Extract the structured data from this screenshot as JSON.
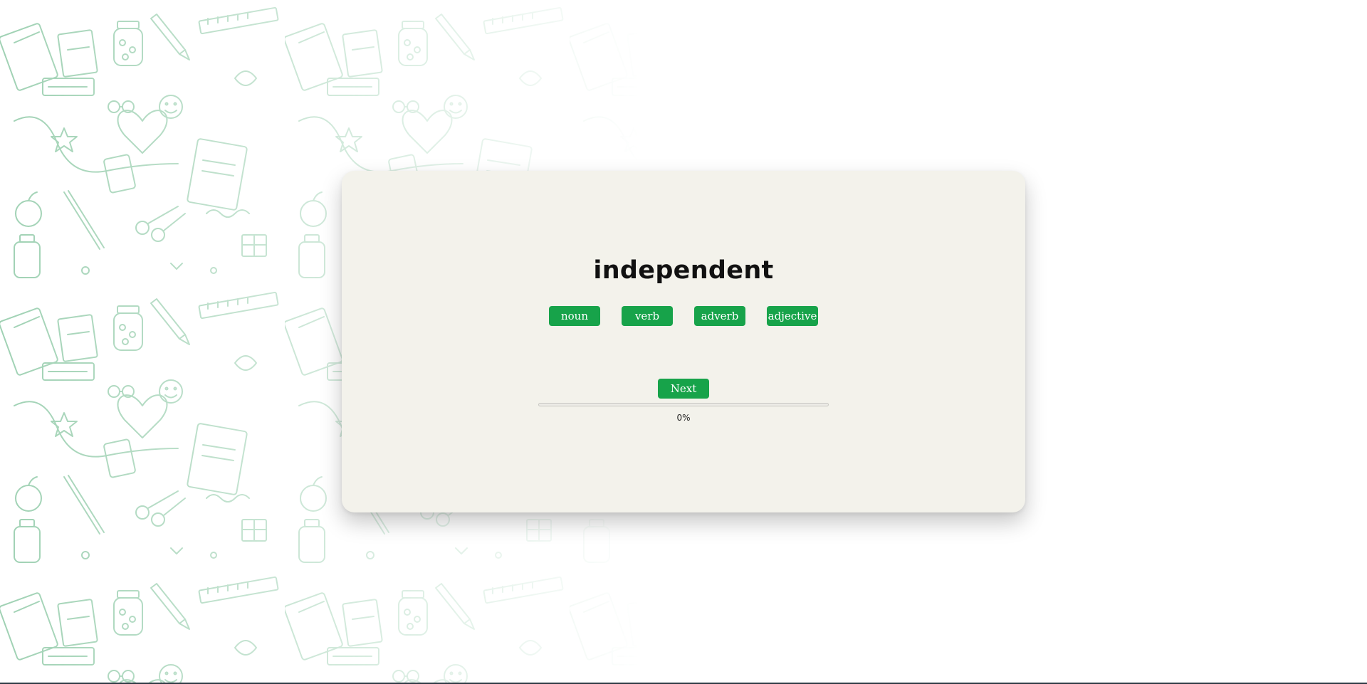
{
  "quiz": {
    "word": "independent",
    "options": [
      "noun",
      "verb",
      "adverb",
      "adjective"
    ],
    "next_label": "Next",
    "progress_value": 0,
    "progress_text": "0%"
  },
  "colors": {
    "accent": "#17a34a",
    "card": "#f3f2eb",
    "doodle": "#7fc29a"
  },
  "background": {
    "pattern_icon": "study-doodle-pattern"
  }
}
